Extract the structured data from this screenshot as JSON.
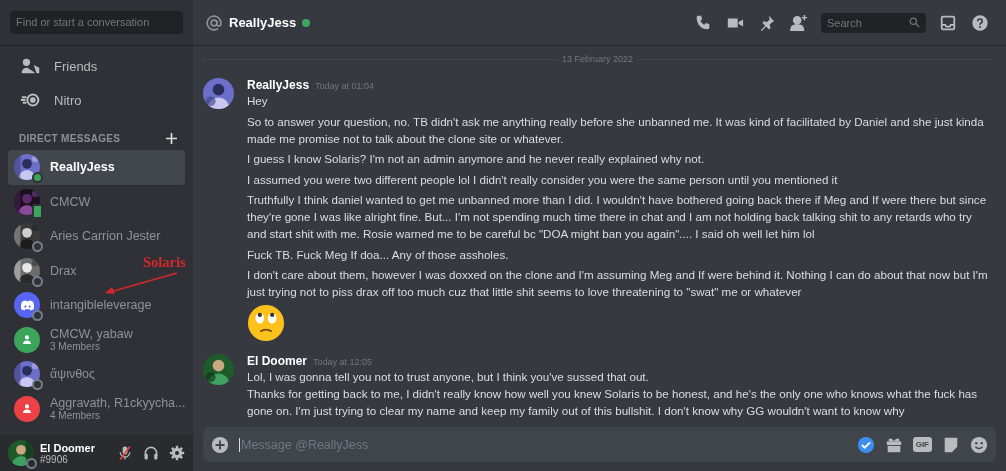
{
  "sidebar": {
    "search_placeholder": "Find or start a conversation",
    "nav": [
      {
        "label": "Friends",
        "kind": "friends"
      },
      {
        "label": "Nitro",
        "kind": "nitro"
      }
    ],
    "section_title": "DIRECT MESSAGES",
    "dms": [
      {
        "name": "ReallyJess",
        "online": true,
        "mobile": false,
        "selected": true
      },
      {
        "name": "CMCW",
        "online": true,
        "mobile": true,
        "selected": false
      },
      {
        "name": "Aries Carrion Jester",
        "online": false,
        "mobile": false,
        "selected": false
      },
      {
        "name": "Drax",
        "online": false,
        "mobile": false,
        "selected": false
      },
      {
        "name": "intangibleleverage",
        "kind": "discord",
        "color": "#5865f2",
        "online": false,
        "mobile": false,
        "selected": false
      },
      {
        "name": "CMCW, yabaw",
        "members": "3 Members",
        "kind": "group",
        "color": "#3ba55c",
        "selected": false
      },
      {
        "name": "ἄψινθος",
        "online": false,
        "mobile": false,
        "selected": false
      },
      {
        "name": "Aggravath, R1ckyycha...",
        "members": "4 Members",
        "kind": "group",
        "color": "#ed4245",
        "selected": false
      }
    ]
  },
  "user_panel": {
    "name": "El Doomer",
    "tag": "#9906",
    "online": false,
    "muted": true
  },
  "annotation": {
    "label": "Solaris"
  },
  "header": {
    "name": "ReallyJess",
    "online": true,
    "search_placeholder": "Search"
  },
  "date_divider": "13 February 2022",
  "messages": [
    {
      "author": "ReallyJess",
      "time": "Today at 01:04",
      "items": [
        {
          "kind": "text",
          "text": "Hey"
        },
        {
          "kind": "text",
          "text": "So to answer your question, no. TB didn't ask me anything really before she unbanned me. It was kind of facilitated by Daniel and she just kinda made me promise not to talk about the clone site or whatever."
        },
        {
          "kind": "text",
          "text": "I guess I know Solaris? I'm not an admin anymore and he never really explained why not."
        },
        {
          "kind": "text",
          "text": "I assumed you were two different people lol I didn't really consider you were the same person until you mentioned it"
        },
        {
          "kind": "text",
          "text": "Truthfully I think daniel wanted to get me unbanned more than I did. I wouldn't have bothered going back there if Meg and If were there but since they're gone I was like alright fine. But... I'm not spending much time there in chat and I am not holding back talking shit to any retards who try and start shit with me. Rosie warned me to be careful bc \"DOA might ban you again\".... I said oh well let him lol"
        },
        {
          "kind": "text",
          "text": "Fuck TB. Fuck Meg If doa... Any of those assholes."
        },
        {
          "kind": "text",
          "text": "I don't care about them, however I was doxxed on the clone and I'm assuming Meg and If were behind it. Nothing I can do about that now but I'm just trying not to piss drax off too much cuz that little shit seems to love threatening to \"swat\" me or whatever"
        },
        {
          "kind": "emoji"
        }
      ]
    },
    {
      "author": "El Doomer",
      "time": "Today at 12:05",
      "items": [
        {
          "kind": "text",
          "text": "Lol, I was gonna tell you not to trust anyone, but I think you've sussed that out."
        },
        {
          "kind": "text",
          "text": "Thanks for getting back to me, I didn't really know how well you knew Solaris to be honest, and he's the only one who knows what the fuck has gone on. I'm just trying to clear my name and keep my family out of this bullshit. I don't know why GG wouldn't want to know why"
        }
      ]
    }
  ],
  "composer": {
    "placeholder": "Message @ReallyJess",
    "gif_label": "GIF"
  }
}
